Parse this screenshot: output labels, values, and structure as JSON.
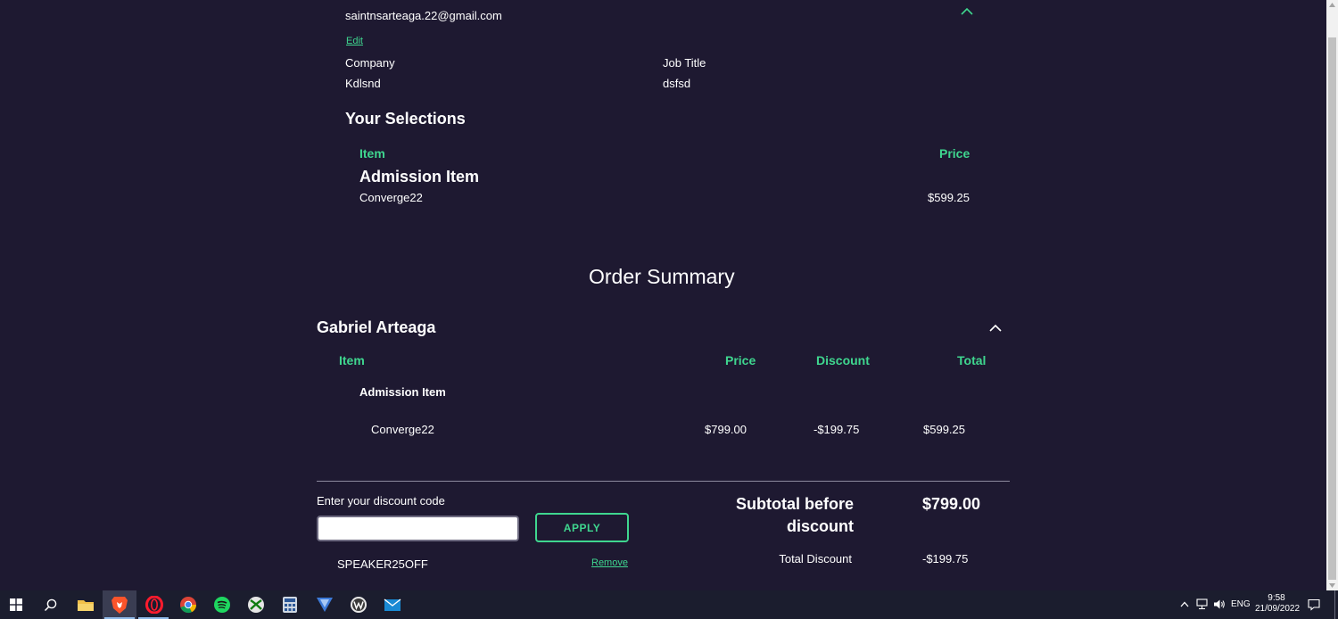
{
  "attendee": {
    "email": "saintnsarteaga.22@gmail.com",
    "edit_label": "Edit",
    "company_label": "Company",
    "company_value": "Kdlsnd",
    "job_title_label": "Job Title",
    "job_title_value": "dsfsd"
  },
  "selections": {
    "heading": "Your Selections",
    "item_header": "Item",
    "price_header": "Price",
    "category": "Admission Item",
    "item_name": "Converge22",
    "item_price": "$599.25"
  },
  "order_summary": {
    "heading": "Order Summary",
    "attendee_name": "Gabriel Arteaga",
    "columns": {
      "item": "Item",
      "price": "Price",
      "discount": "Discount",
      "total": "Total"
    },
    "category": "Admission Item",
    "row": {
      "item": "Converge22",
      "price": "$799.00",
      "discount": "-$199.75",
      "total": "$599.25"
    }
  },
  "discount": {
    "label": "Enter your discount code",
    "input_value": "",
    "apply_label": "APPLY",
    "applied_code": "SPEAKER25OFF",
    "remove_label": "Remove"
  },
  "totals": {
    "subtotal_label_line1": "Subtotal before",
    "subtotal_label_line2": "discount",
    "subtotal_value": "$799.00",
    "total_discount_label": "Total Discount",
    "total_discount_value": "-$199.75"
  },
  "taskbar": {
    "icons": [
      "windows-start-icon",
      "search-icon",
      "file-explorer-icon",
      "brave-browser-icon",
      "opera-browser-icon",
      "chrome-icon",
      "spotify-icon",
      "xbox-icon",
      "calculator-icon",
      "vpn-icon",
      "wordpress-icon",
      "mail-icon"
    ],
    "language": "ENG",
    "time": "9:58",
    "date": "21/09/2022"
  },
  "colors": {
    "background": "#1e1931",
    "accent": "#3fd68f",
    "text": "#ffffff"
  }
}
